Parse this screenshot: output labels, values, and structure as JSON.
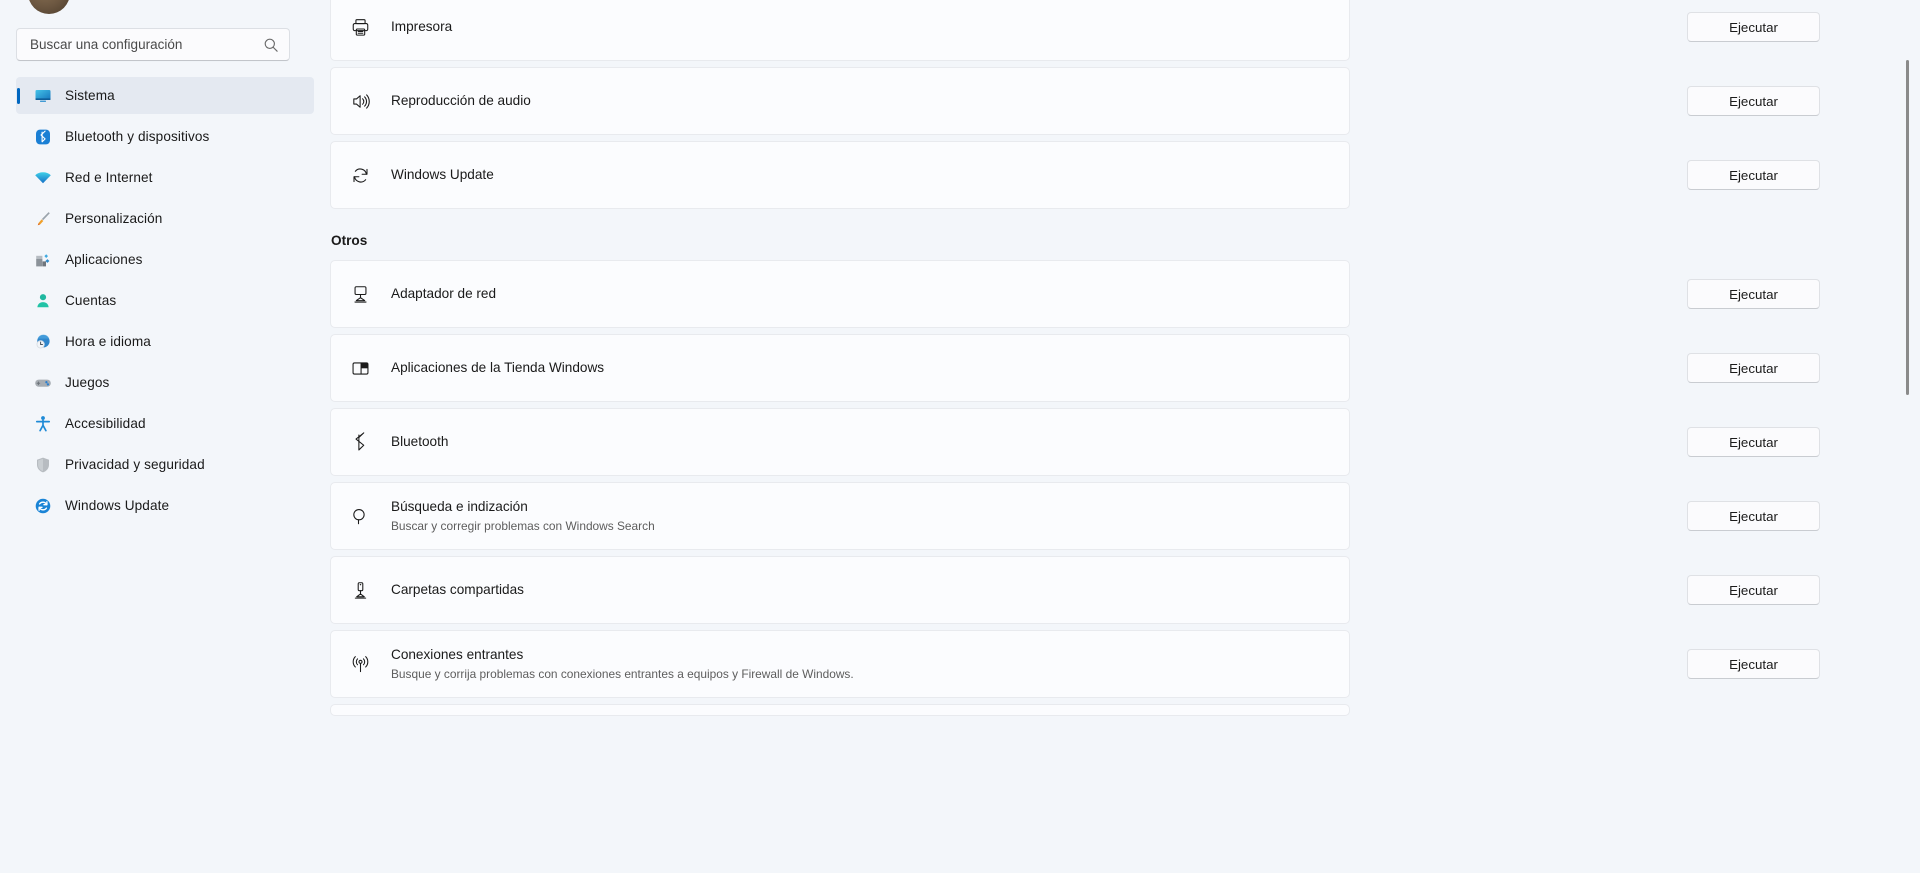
{
  "sidebar": {
    "search": {
      "placeholder": "Buscar una configuración",
      "value": "",
      "icon": "search-icon"
    },
    "items": [
      {
        "label": "Sistema",
        "icon": "system-monitor-icon",
        "active": true
      },
      {
        "label": "Bluetooth y dispositivos",
        "icon": "bluetooth-icon",
        "active": false
      },
      {
        "label": "Red e Internet",
        "icon": "wifi-icon",
        "active": false
      },
      {
        "label": "Personalización",
        "icon": "paintbrush-icon",
        "active": false
      },
      {
        "label": "Aplicaciones",
        "icon": "apps-icon",
        "active": false
      },
      {
        "label": "Cuentas",
        "icon": "person-icon",
        "active": false
      },
      {
        "label": "Hora e idioma",
        "icon": "clock-globe-icon",
        "active": false
      },
      {
        "label": "Juegos",
        "icon": "gamepad-icon",
        "active": false
      },
      {
        "label": "Accesibilidad",
        "icon": "accessibility-icon",
        "active": false
      },
      {
        "label": "Privacidad y seguridad",
        "icon": "shield-icon",
        "active": false
      },
      {
        "label": "Windows Update",
        "icon": "windows-update-icon",
        "active": false
      }
    ]
  },
  "main": {
    "run_label": "Ejecutar",
    "section_heading": "Otros",
    "top_rows": [
      {
        "title": "Impresora",
        "subtitle": "",
        "icon": "printer-icon"
      },
      {
        "title": "Reproducción de audio",
        "subtitle": "",
        "icon": "speaker-icon"
      },
      {
        "title": "Windows Update",
        "subtitle": "",
        "icon": "refresh-icon"
      }
    ],
    "other_rows": [
      {
        "title": "Adaptador de red",
        "subtitle": "",
        "icon": "network-adapter-icon"
      },
      {
        "title": "Aplicaciones de la Tienda Windows",
        "subtitle": "",
        "icon": "store-app-icon"
      },
      {
        "title": "Bluetooth",
        "subtitle": "",
        "icon": "bluetooth-outline-icon"
      },
      {
        "title": "Búsqueda e indización",
        "subtitle": "Buscar y corregir problemas con Windows Search",
        "icon": "magnifier-icon"
      },
      {
        "title": "Carpetas compartidas",
        "subtitle": "",
        "icon": "shared-folder-icon"
      },
      {
        "title": "Conexiones entrantes",
        "subtitle": "Busque y corrija problemas con conexiones entrantes a equipos y Firewall de Windows.",
        "icon": "broadcast-icon"
      }
    ]
  },
  "colors": {
    "accent": "#0067c0",
    "page_bg": "#f3f6fa",
    "card_bg": "#fbfcfe",
    "text": "#1a1a1a",
    "subtext": "#5d5d5d"
  }
}
